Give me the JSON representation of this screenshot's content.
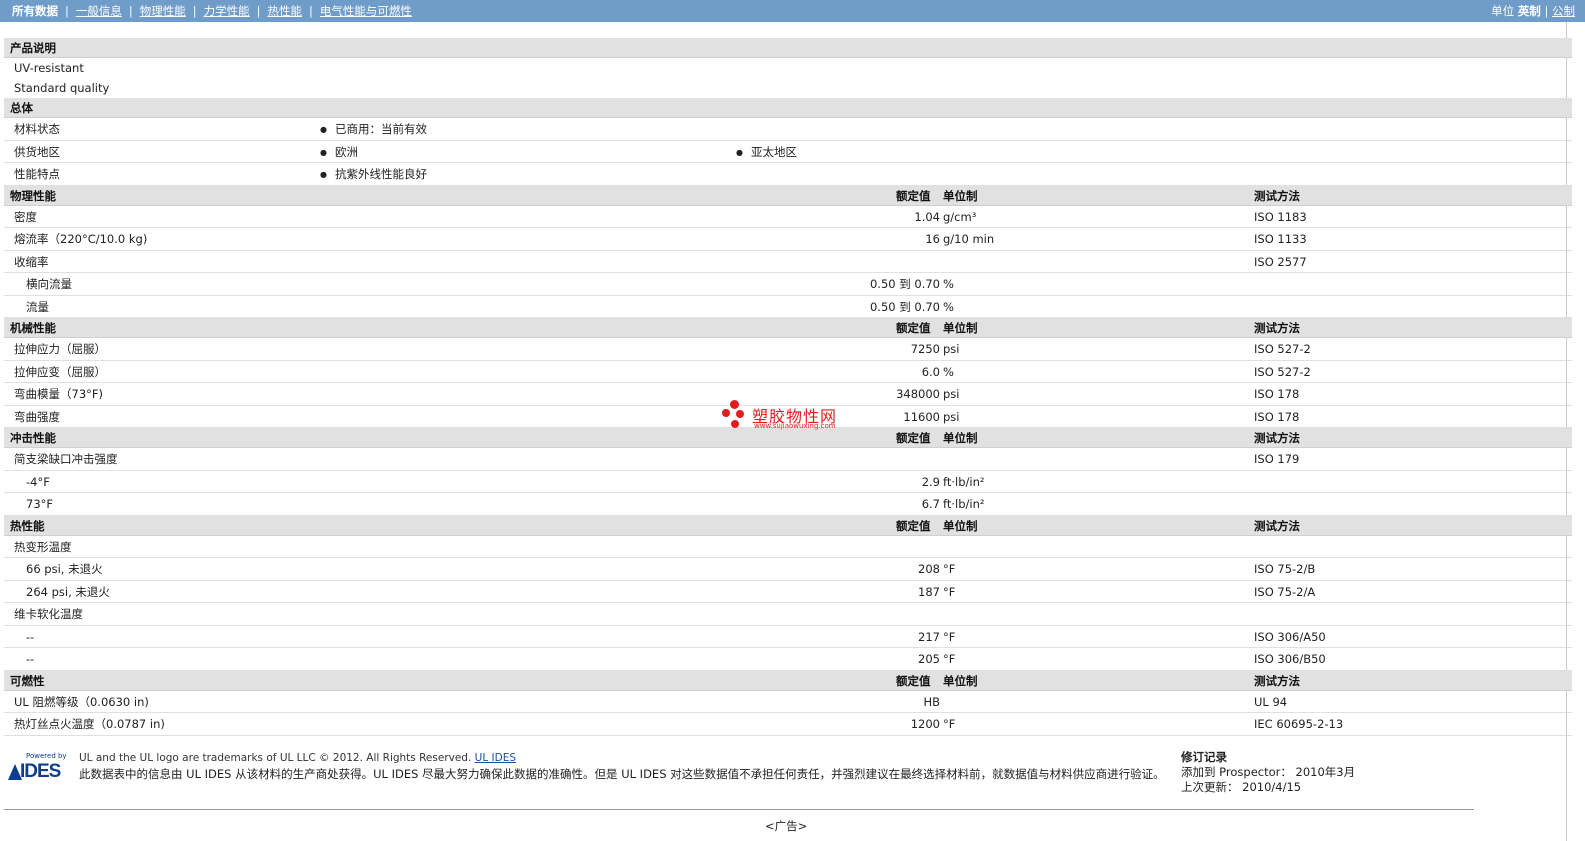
{
  "nav": {
    "items": [
      "所有数据",
      "一般信息",
      "物理性能",
      "力学性能",
      "热性能",
      "电气性能与可燃性"
    ],
    "units_label": "单位",
    "unit_english": "英制",
    "unit_metric": "公制",
    "unit_sep": "|"
  },
  "columns": {
    "value": "额定值",
    "unit": "单位制",
    "test": "测试方法"
  },
  "product": {
    "title": "产品说明",
    "lines": [
      "UV-resistant",
      "Standard quality"
    ]
  },
  "general": {
    "title": "总体",
    "rows": [
      {
        "label": "材料状态",
        "b1": "已商用：当前有效",
        "b2": ""
      },
      {
        "label": "供货地区",
        "b1": "欧洲",
        "b2": "亚太地区"
      },
      {
        "label": "性能特点",
        "b1": "抗紫外线性能良好",
        "b2": ""
      }
    ]
  },
  "sections": [
    {
      "title": "物理性能",
      "rows": [
        {
          "label": "密度",
          "indent": false,
          "value": "1.04",
          "unit": "g/cm³",
          "test": "ISO 1183"
        },
        {
          "label": "熔流率（220°C/10.0 kg)",
          "indent": false,
          "value": "16",
          "unit": "g/10 min",
          "test": "ISO 1133"
        },
        {
          "label": "收缩率",
          "indent": false,
          "value": "",
          "unit": "",
          "test": "ISO 2577"
        },
        {
          "label": "横向流量",
          "indent": true,
          "value": "0.50 到  0.70",
          "unit": "%",
          "test": ""
        },
        {
          "label": "流量",
          "indent": true,
          "value": "0.50 到  0.70",
          "unit": "%",
          "test": ""
        }
      ]
    },
    {
      "title": "机械性能",
      "rows": [
        {
          "label": "拉伸应力（屈服）",
          "indent": false,
          "value": "7250",
          "unit": "psi",
          "test": "ISO 527-2"
        },
        {
          "label": "拉伸应变（屈服）",
          "indent": false,
          "value": "6.0",
          "unit": "%",
          "test": "ISO 527-2"
        },
        {
          "label": "弯曲模量（73°F)",
          "indent": false,
          "value": "348000",
          "unit": "psi",
          "test": "ISO 178"
        },
        {
          "label": "弯曲强度",
          "indent": false,
          "value": "11600",
          "unit": "psi",
          "test": "ISO 178"
        }
      ]
    },
    {
      "title": "冲击性能",
      "rows": [
        {
          "label": "简支梁缺口冲击强度",
          "indent": false,
          "value": "",
          "unit": "",
          "test": "ISO 179"
        },
        {
          "label": "-4°F",
          "indent": true,
          "value": "2.9",
          "unit": "ft·lb/in²",
          "test": ""
        },
        {
          "label": "73°F",
          "indent": true,
          "value": "6.7",
          "unit": "ft·lb/in²",
          "test": ""
        }
      ]
    },
    {
      "title": "热性能",
      "rows": [
        {
          "label": "热变形温度",
          "indent": false,
          "value": "",
          "unit": "",
          "test": ""
        },
        {
          "label": "66 psi, 未退火",
          "indent": true,
          "value": "208",
          "unit": "°F",
          "test": "ISO 75-2/B"
        },
        {
          "label": "264 psi, 未退火",
          "indent": true,
          "value": "187",
          "unit": "°F",
          "test": "ISO 75-2/A"
        },
        {
          "label": "维卡软化温度",
          "indent": false,
          "value": "",
          "unit": "",
          "test": ""
        },
        {
          "label": "--",
          "indent": true,
          "value": "217",
          "unit": "°F",
          "test": "ISO 306/A50"
        },
        {
          "label": "--",
          "indent": true,
          "value": "205",
          "unit": "°F",
          "test": "ISO 306/B50"
        }
      ]
    },
    {
      "title": "可燃性",
      "rows": [
        {
          "label": "UL 阻燃等级（0.0630 in)",
          "indent": false,
          "value": "HB",
          "unit": "",
          "test": "UL 94"
        },
        {
          "label": "热灯丝点火温度（0.0787 in)",
          "indent": false,
          "value": "1200",
          "unit": "°F",
          "test": "IEC 60695-2-13"
        }
      ]
    }
  ],
  "watermark": {
    "name": "塑胶物性网",
    "url": "www.sujiaowuxing.com"
  },
  "footer": {
    "logo_powered": "Powered by",
    "logo_text": "IDES",
    "trademark": "UL and the UL logo are trademarks of UL LLC © 2012. All Rights Reserved.",
    "trademark_link": "UL IDES",
    "disclaimer": "此数据表中的信息由  UL IDES 从该材料的生产商处获得。UL IDES 尽最大努力确保此数据的准确性。但是  UL IDES 对这些数据值不承担任何责任，并强烈建议在最终选择材料前，就数据值与材料供应商进行验证。",
    "revision_title": "修订记录",
    "added": "添加到  Prospector：  2010年3月",
    "updated": "上次更新：  2010/4/15"
  },
  "ad_label": "<广告>"
}
